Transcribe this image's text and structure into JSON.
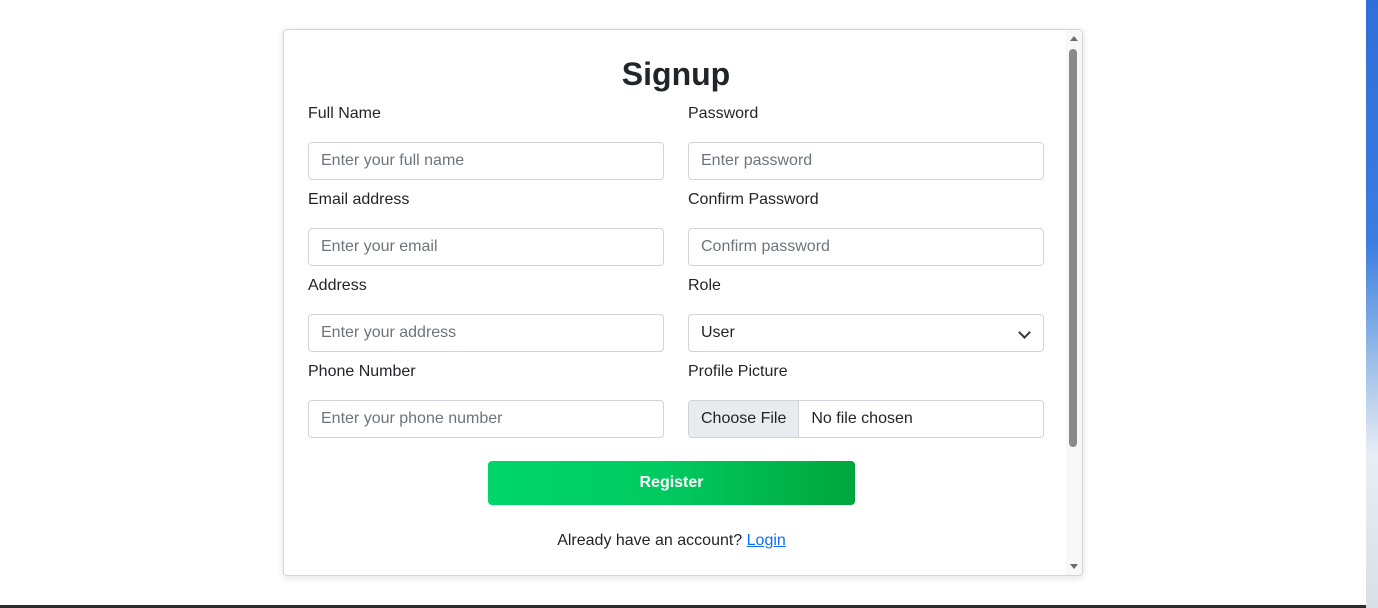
{
  "form": {
    "title": "Signup",
    "fields": {
      "full_name": {
        "label": "Full Name",
        "placeholder": "Enter your full name"
      },
      "password": {
        "label": "Password",
        "placeholder": "Enter password"
      },
      "email": {
        "label": "Email address",
        "placeholder": "Enter your email"
      },
      "confirm_password": {
        "label": "Confirm Password",
        "placeholder": "Confirm password"
      },
      "address": {
        "label": "Address",
        "placeholder": "Enter your address"
      },
      "role": {
        "label": "Role",
        "value": "User"
      },
      "phone": {
        "label": "Phone Number",
        "placeholder": "Enter your phone number"
      },
      "profile_picture": {
        "label": "Profile Picture",
        "button": "Choose File",
        "status": "No file chosen"
      }
    },
    "register_label": "Register",
    "footer_text": "Already have an account?",
    "login_link": "Login"
  },
  "colors": {
    "button_gradient_start": "#00d66b",
    "button_gradient_end": "#00a63c",
    "link": "#0d6efd"
  },
  "icons": [
    "chevron-down-icon",
    "scroll-up-arrow-icon",
    "scroll-down-arrow-icon"
  ]
}
